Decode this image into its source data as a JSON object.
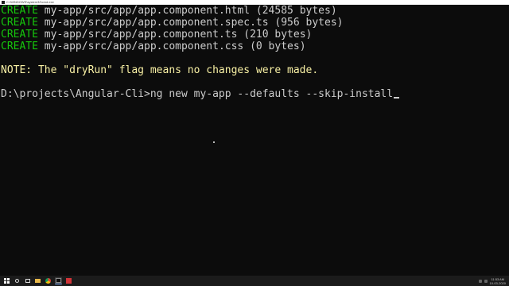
{
  "window": {
    "title": "C:\\WINDOWS\\system32\\cmd.exe"
  },
  "console": {
    "lines": [
      {
        "kind": "create",
        "tag": "CREATE",
        "text": " my-app/src/app/app.component.html (24585 bytes)"
      },
      {
        "kind": "create",
        "tag": "CREATE",
        "text": " my-app/src/app/app.component.spec.ts (956 bytes)"
      },
      {
        "kind": "create",
        "tag": "CREATE",
        "text": " my-app/src/app/app.component.ts (210 bytes)"
      },
      {
        "kind": "create",
        "tag": "CREATE",
        "text": " my-app/src/app/app.component.css (0 bytes)"
      },
      {
        "kind": "blank",
        "text": ""
      },
      {
        "kind": "note",
        "text": "NOTE: The \"dryRun\" flag means no changes were made."
      },
      {
        "kind": "blank",
        "text": ""
      },
      {
        "kind": "prompt",
        "prompt": "D:\\projects\\Angular-Cli>",
        "command": "ng new my-app --defaults --skip-install"
      }
    ]
  },
  "colors": {
    "background": "#0c0c0c",
    "foreground": "#cccccc",
    "create": "#16c60c",
    "note": "#f9f1a5"
  },
  "taskbar": {
    "icons": [
      "windows-start-icon",
      "search-icon",
      "task-view-icon",
      "file-explorer-icon",
      "chrome-icon",
      "terminal-icon",
      "red-app-icon"
    ],
    "clock_time": "11:53 AM",
    "clock_date": "10-03-2020"
  }
}
